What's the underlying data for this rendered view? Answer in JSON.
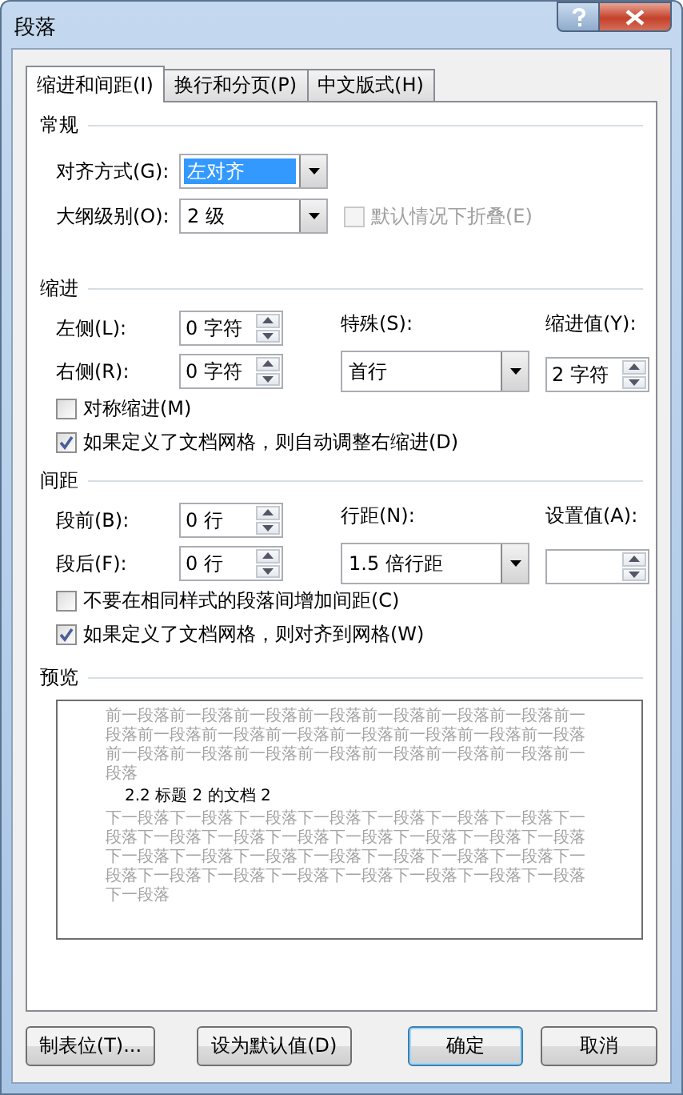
{
  "window": {
    "title": "段落"
  },
  "tabs": [
    {
      "label": "缩进和间距(I)",
      "selected": true
    },
    {
      "label": "换行和分页(P)",
      "selected": false
    },
    {
      "label": "中文版式(H)",
      "selected": false
    }
  ],
  "general": {
    "heading": "常规",
    "alignment": {
      "label": "对齐方式(G):",
      "value": "左对齐",
      "highlighted": true
    },
    "outline_level": {
      "label": "大纲级别(O):",
      "value": "2 级",
      "highlighted": false
    },
    "collapse": {
      "label": "默认情况下折叠(E)",
      "checked": false,
      "disabled": true
    }
  },
  "indentation": {
    "heading": "缩进",
    "left": {
      "label": "左侧(L):",
      "value": "0 字符"
    },
    "right": {
      "label": "右侧(R):",
      "value": "0 字符"
    },
    "special": {
      "label": "特殊(S):",
      "value": "首行"
    },
    "by": {
      "label": "缩进值(Y):",
      "value": "2 字符"
    },
    "options": [
      {
        "label": "对称缩进(M)",
        "checked": false,
        "disabled": false
      },
      {
        "label": "如果定义了文档网格，则自动调整右缩进(D)",
        "checked": true,
        "disabled": false
      }
    ]
  },
  "spacing": {
    "heading": "间距",
    "before": {
      "label": "段前(B):",
      "value": "0 行"
    },
    "after": {
      "label": "段后(F):",
      "value": "0 行"
    },
    "line_spacing": {
      "label": "行距(N):",
      "value": "1.5 倍行距"
    },
    "at": {
      "label": "设置值(A):"
    },
    "options": [
      {
        "label": "不要在相同样式的段落间增加间距(C)",
        "checked": false,
        "disabled": false
      },
      {
        "label": "如果定义了文档网格，则对齐到网格(W)",
        "checked": true,
        "disabled": false
      }
    ]
  },
  "preview": {
    "heading": "预览",
    "previous_text": "前一段落前一段落前一段落前一段落前一段落前一段落前一段落前一段落前一段落前一段落前一段落前一段落前一段落前一段落前一段落前一段落前一段落前一段落前一段落前一段落前一段落前一段落前一段落",
    "sample_text": "2.2 标题 2 的文档 2",
    "next_text": "下一段落下一段落下一段落下一段落下一段落下一段落下一段落下一段落下一段落下一段落下一段落下一段落下一段落下一段落下一段落下一段落下一段落下一段落下一段落下一段落下一段落下一段落下一段落下一段落下一段落下一段落下一段落下一段落下一段落下一段落下一段落"
  },
  "buttons": [
    {
      "label": "制表位(T)...",
      "default": false
    },
    {
      "label": "设为默认值(D)",
      "default": false
    },
    {
      "label": "确定",
      "default": true
    },
    {
      "label": "取消",
      "default": false
    }
  ]
}
